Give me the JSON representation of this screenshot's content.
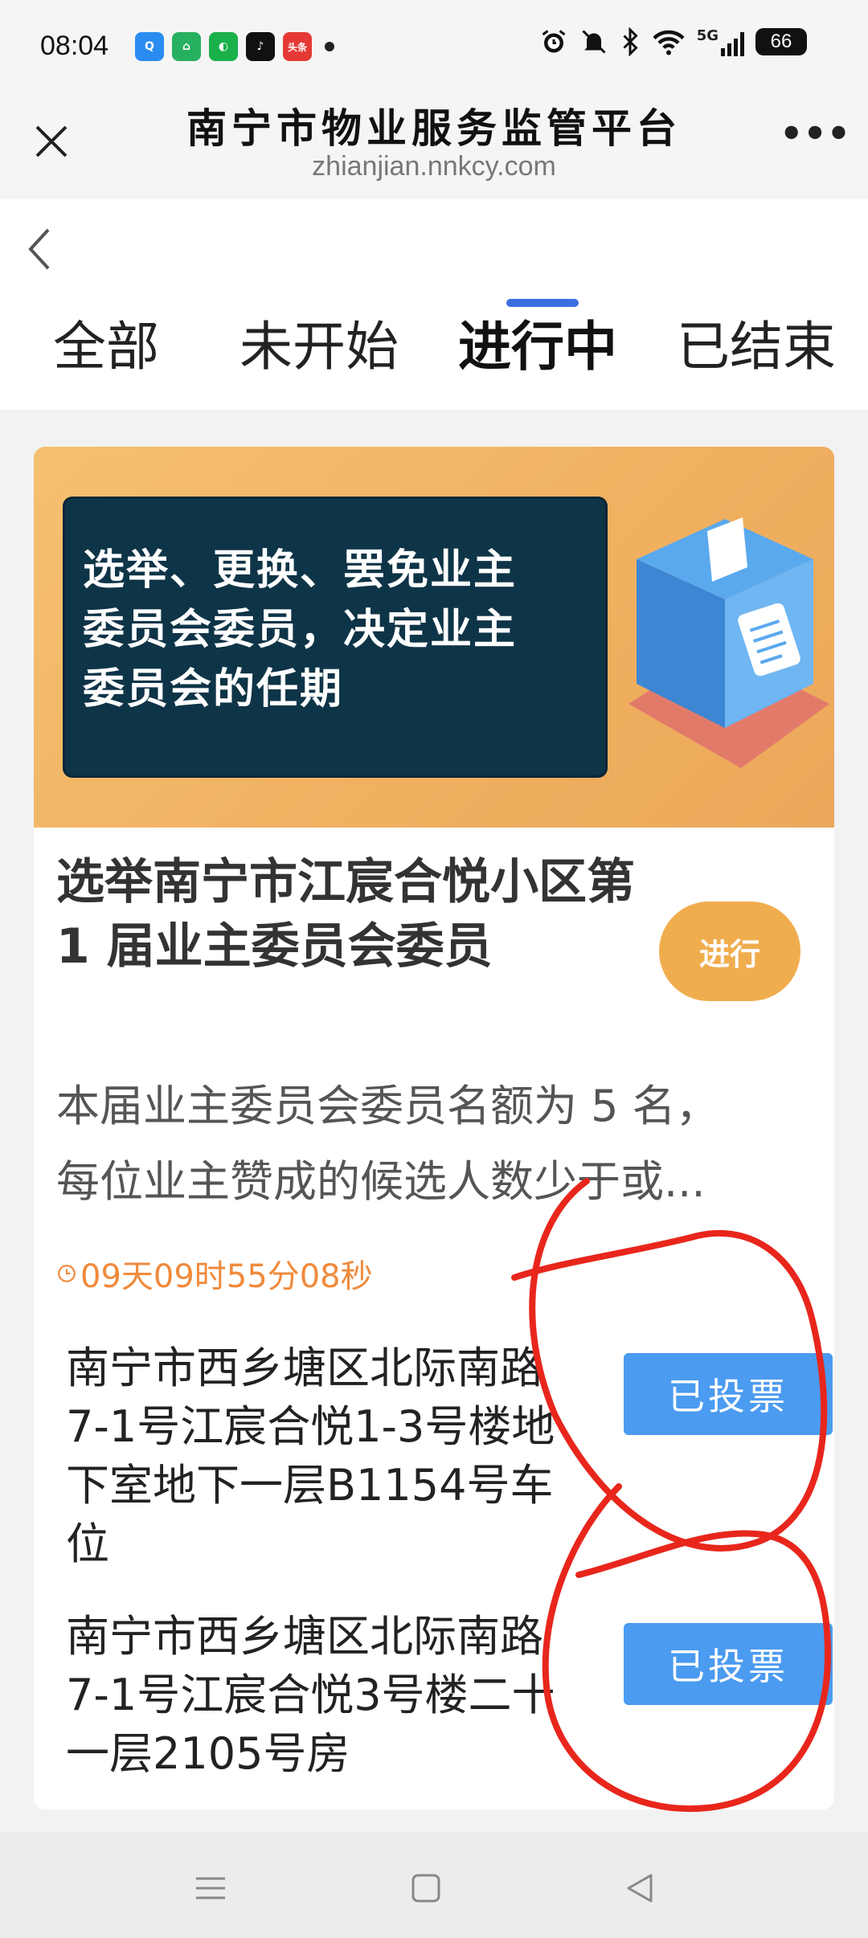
{
  "status_bar": {
    "time": "08:04",
    "app_icons": [
      {
        "name": "browser-app-icon",
        "color": "#2a8cf0",
        "glyph": "Q"
      },
      {
        "name": "home-app-icon",
        "color": "#27b05f",
        "glyph": "⌂"
      },
      {
        "name": "panda-app-icon",
        "color": "#1ab04a",
        "glyph": "◐"
      },
      {
        "name": "tiktok-app-icon",
        "color": "#111111",
        "glyph": "♪"
      },
      {
        "name": "toutiao-app-icon",
        "color": "#e53935",
        "glyph": "头条"
      }
    ],
    "icons": [
      "alarm-icon",
      "mute-icon",
      "bluetooth-icon",
      "wifi-icon",
      "5g-signal-icon"
    ],
    "network": "5G",
    "battery": "66"
  },
  "header": {
    "title": "南宁市物业服务监管平台",
    "url": "zhianjian.nnkcy.com",
    "more": "•••"
  },
  "tabs": [
    {
      "label": "全部",
      "active": false
    },
    {
      "label": "未开始",
      "active": false
    },
    {
      "label": "进行中",
      "active": true
    },
    {
      "label": "已结束",
      "active": false
    }
  ],
  "card": {
    "banner_lines": [
      "选举、更换、罢免业主",
      "委员会委员，决定业主",
      "委员会的任期"
    ],
    "title": "选举南宁市江宸合悦小区第 1 届业主委员会委员",
    "status": "进行",
    "description_lines": [
      "本届业主委员会委员名额为 5 名，",
      "每位业主赞成的候选人数少于或..."
    ],
    "countdown": "09天09时55分08秒",
    "votes": [
      {
        "address": "南宁市西乡塘区北际南路7-1号江宸合悦1-3号楼地下室地下一层B1154号车位",
        "button": "已投票"
      },
      {
        "address": "南宁市西乡塘区北际南路7-1号江宸合悦3号楼二十一层2105号房",
        "button": "已投票"
      }
    ]
  },
  "colors": {
    "accent": "#3b6fe0",
    "status_pill": "#f0ad4e",
    "vote_button": "#4b9bf0",
    "countdown": "#f08a3c",
    "annotation": "#e8261c"
  }
}
